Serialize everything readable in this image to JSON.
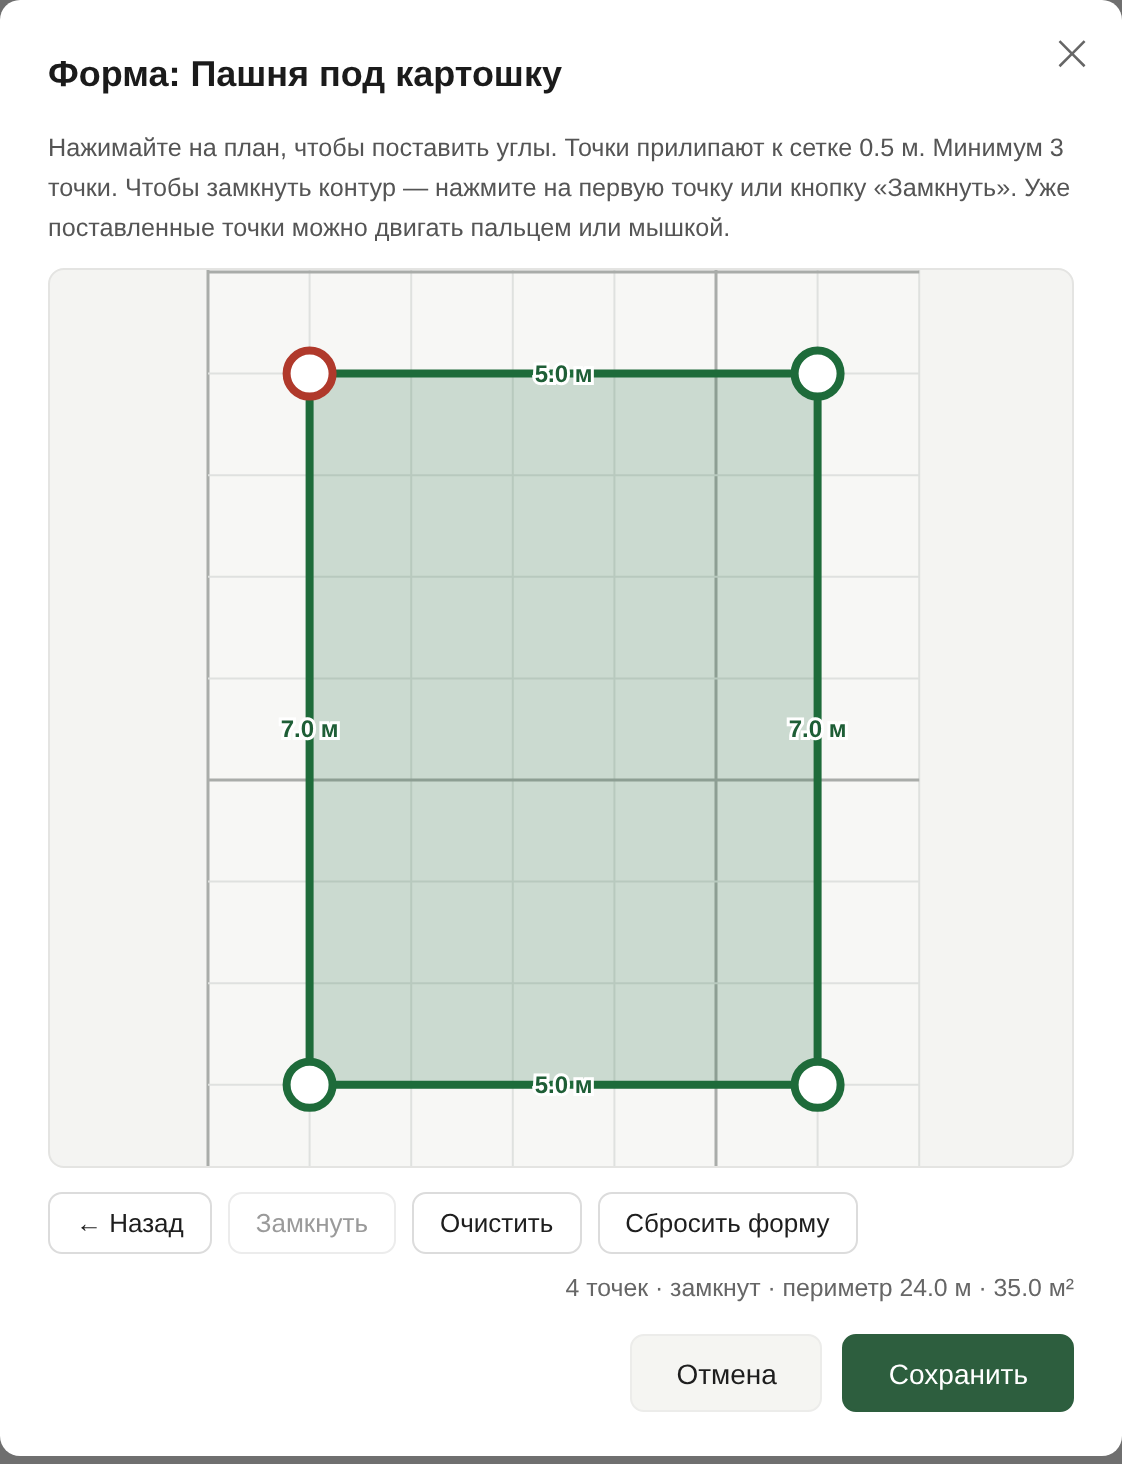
{
  "dialog": {
    "title": "Форма: Пашня под картошку",
    "close": "×",
    "description": "Нажимайте на план, чтобы поставить углы. Точки прилипают к сетке 0.5 м. Минимум 3 точки. Чтобы замкнуть контур — нажмите на первую точку или кнопку «Замкнуть». Уже поставленные точки можно двигать пальцем или мышкой."
  },
  "plan": {
    "closed": true,
    "points": [
      {
        "color": "#b0392b"
      },
      {
        "color": "#1e6b3a"
      },
      {
        "color": "#1e6b3a"
      },
      {
        "color": "#1e6b3a"
      }
    ],
    "edges": [
      {
        "label": "5.0 м"
      },
      {
        "label": "7.0 м"
      },
      {
        "label": "5.0 м"
      },
      {
        "label": "7.0 м"
      }
    ]
  },
  "tools": [
    {
      "label": "← Назад",
      "disabled": false
    },
    {
      "label": "Замкнуть",
      "disabled": true
    },
    {
      "label": "Очистить",
      "disabled": false
    },
    {
      "label": "Сбросить форму",
      "disabled": false
    }
  ],
  "status": "4 точек · замкнут · периметр 24.0 м · 35.0 м²",
  "footer": [
    {
      "label": "Отмена",
      "kind": "secondary"
    },
    {
      "label": "Сохранить",
      "kind": "primary"
    }
  ]
}
